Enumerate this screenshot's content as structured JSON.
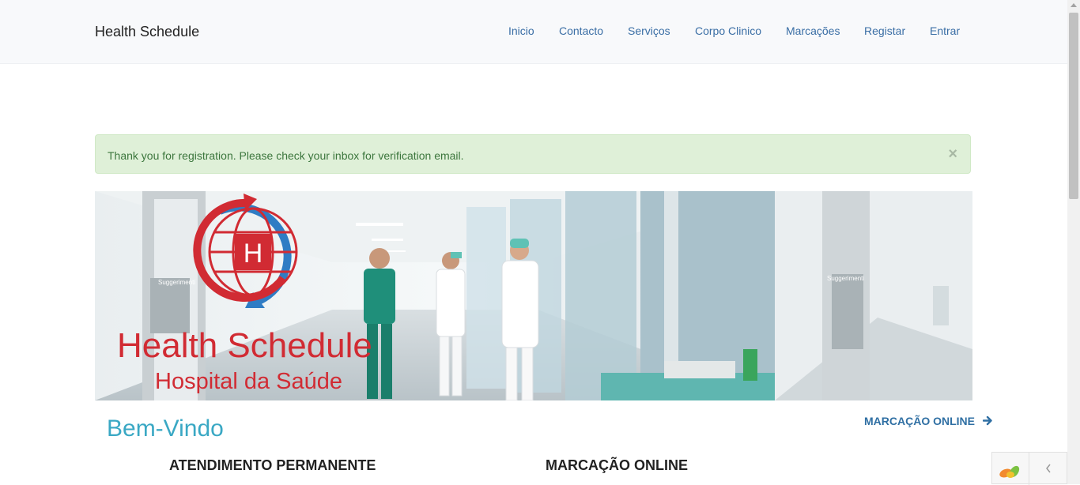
{
  "navbar": {
    "brand": "Health Schedule",
    "links": [
      "Inicio",
      "Contacto",
      "Serviços",
      "Corpo Clinico",
      "Marcações",
      "Registar",
      "Entrar"
    ]
  },
  "alert": {
    "message": "Thank you for registration. Please check your inbox for verification email.",
    "close_symbol": "×"
  },
  "banner": {
    "logo_letter": "H",
    "title": "Health Schedule",
    "subtitle": "Hospital da Saúde",
    "sign_text": "Suggerimenti"
  },
  "welcome": {
    "title": "Bem-Vindo",
    "cta_label": "MARCAÇÃO ONLINE"
  },
  "columns": [
    "ATENDIMENTO PERMANENTE",
    "MARCAÇÃO ONLINE"
  ],
  "colors": {
    "nav_link": "#3a6ea5",
    "alert_bg": "#dff0d8",
    "alert_text": "#3c763d",
    "welcome": "#3aa8c4",
    "logo_red": "#d12b33",
    "logo_blue": "#2f7cc4"
  },
  "icons": {
    "close": "close-icon",
    "cta_arrow": "arrow-right-icon",
    "widget_logo": "leaf-logo-icon",
    "widget_toggle": "chevron-left-icon"
  }
}
